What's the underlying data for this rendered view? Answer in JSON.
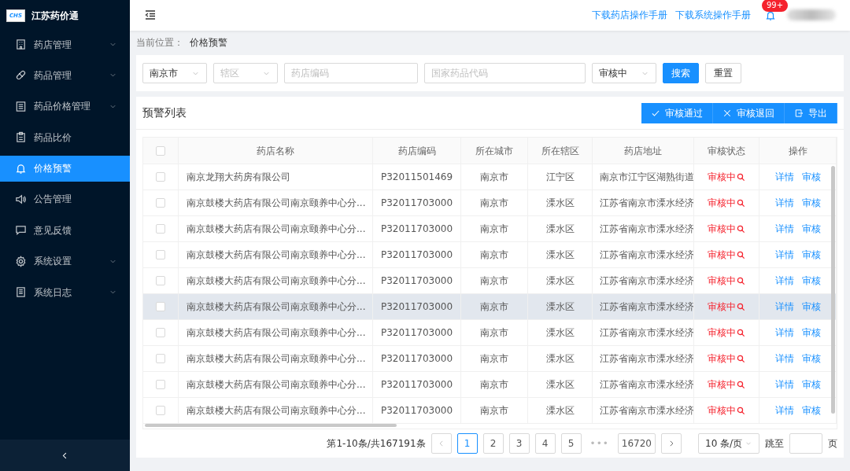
{
  "app": {
    "title": "江苏药价通",
    "logo": "CHS"
  },
  "sidebar": {
    "items": [
      {
        "label": "药店管理",
        "expandable": true,
        "selected": false
      },
      {
        "label": "药品管理",
        "expandable": true,
        "selected": false
      },
      {
        "label": "药品价格管理",
        "expandable": true,
        "selected": false
      },
      {
        "label": "药品比价",
        "expandable": false,
        "selected": false
      },
      {
        "label": "价格预警",
        "expandable": false,
        "selected": true
      },
      {
        "label": "公告管理",
        "expandable": false,
        "selected": false
      },
      {
        "label": "意见反馈",
        "expandable": false,
        "selected": false
      },
      {
        "label": "系统设置",
        "expandable": true,
        "selected": false
      },
      {
        "label": "系统日志",
        "expandable": true,
        "selected": false
      }
    ]
  },
  "header": {
    "links": [
      "下载药店操作手册",
      "下载系统操作手册"
    ],
    "notification_badge": "99+"
  },
  "breadcrumb": {
    "label": "当前位置：",
    "current": "价格预警"
  },
  "filters": [
    {
      "kind": "select",
      "value": "南京市"
    },
    {
      "kind": "select",
      "placeholder": "辖区"
    },
    {
      "kind": "input",
      "placeholder": "药店编码"
    },
    {
      "kind": "input",
      "placeholder": "国家药品代码"
    },
    {
      "kind": "select",
      "value": "审核中"
    }
  ],
  "filter_buttons": [
    {
      "label": "搜索",
      "primary": true
    },
    {
      "label": "重置",
      "primary": false
    }
  ],
  "panel": {
    "title": "预警列表",
    "actions": [
      "审核通过",
      "审核退回",
      "导出"
    ]
  },
  "table": {
    "header_checked": false,
    "columns": [
      "药店名称",
      "药店编码",
      "所在城市",
      "所在辖区",
      "药店地址",
      "审核状态",
      "操作"
    ],
    "rows": [
      {
        "checked": false,
        "highlighted": false,
        "cells": [
          "南京龙翔大药房有限公司",
          "P32011501469",
          "南京市",
          "江宁区",
          "南京市江宁区湖熟街道"
        ],
        "status": "审核中",
        "actions": [
          "详情",
          "审核"
        ]
      },
      {
        "checked": false,
        "highlighted": false,
        "cells": [
          "南京鼓楼大药店有限公司南京颐养中心分...",
          "P32011703000",
          "南京市",
          "溧水区",
          "江苏省南京市溧水经济"
        ],
        "status": "审核中",
        "actions": [
          "详情",
          "审核"
        ]
      },
      {
        "checked": false,
        "highlighted": false,
        "cells": [
          "南京鼓楼大药店有限公司南京颐养中心分...",
          "P32011703000",
          "南京市",
          "溧水区",
          "江苏省南京市溧水经济"
        ],
        "status": "审核中",
        "actions": [
          "详情",
          "审核"
        ]
      },
      {
        "checked": false,
        "highlighted": false,
        "cells": [
          "南京鼓楼大药店有限公司南京颐养中心分...",
          "P32011703000",
          "南京市",
          "溧水区",
          "江苏省南京市溧水经济"
        ],
        "status": "审核中",
        "actions": [
          "详情",
          "审核"
        ]
      },
      {
        "checked": false,
        "highlighted": false,
        "cells": [
          "南京鼓楼大药店有限公司南京颐养中心分...",
          "P32011703000",
          "南京市",
          "溧水区",
          "江苏省南京市溧水经济"
        ],
        "status": "审核中",
        "actions": [
          "详情",
          "审核"
        ]
      },
      {
        "checked": false,
        "highlighted": true,
        "cells": [
          "南京鼓楼大药店有限公司南京颐养中心分...",
          "P32011703000",
          "南京市",
          "溧水区",
          "江苏省南京市溧水经济"
        ],
        "status": "审核中",
        "actions": [
          "详情",
          "审核"
        ]
      },
      {
        "checked": false,
        "highlighted": false,
        "cells": [
          "南京鼓楼大药店有限公司南京颐养中心分...",
          "P32011703000",
          "南京市",
          "溧水区",
          "江苏省南京市溧水经济"
        ],
        "status": "审核中",
        "actions": [
          "详情",
          "审核"
        ]
      },
      {
        "checked": false,
        "highlighted": false,
        "cells": [
          "南京鼓楼大药店有限公司南京颐养中心分...",
          "P32011703000",
          "南京市",
          "溧水区",
          "江苏省南京市溧水经济"
        ],
        "status": "审核中",
        "actions": [
          "详情",
          "审核"
        ]
      },
      {
        "checked": false,
        "highlighted": false,
        "cells": [
          "南京鼓楼大药店有限公司南京颐养中心分...",
          "P32011703000",
          "南京市",
          "溧水区",
          "江苏省南京市溧水经济"
        ],
        "status": "审核中",
        "actions": [
          "详情",
          "审核"
        ]
      },
      {
        "checked": false,
        "highlighted": false,
        "cells": [
          "南京鼓楼大药店有限公司南京颐养中心分...",
          "P32011703000",
          "南京市",
          "溧水区",
          "江苏省南京市溧水经济"
        ],
        "status": "审核中",
        "actions": [
          "详情",
          "审核"
        ]
      }
    ]
  },
  "pagination": {
    "summary": "第1-10条/共167191条",
    "pages": [
      {
        "label": "1",
        "selected": true
      },
      {
        "label": "2",
        "selected": false
      },
      {
        "label": "3",
        "selected": false
      },
      {
        "label": "4",
        "selected": false
      },
      {
        "label": "5",
        "selected": false
      },
      {
        "label": "•••",
        "kind": "ellipsis"
      },
      {
        "label": "16720",
        "selected": false
      }
    ],
    "page_size": "10 条/页",
    "jump_label": "跳至",
    "jump_suffix": "页"
  }
}
